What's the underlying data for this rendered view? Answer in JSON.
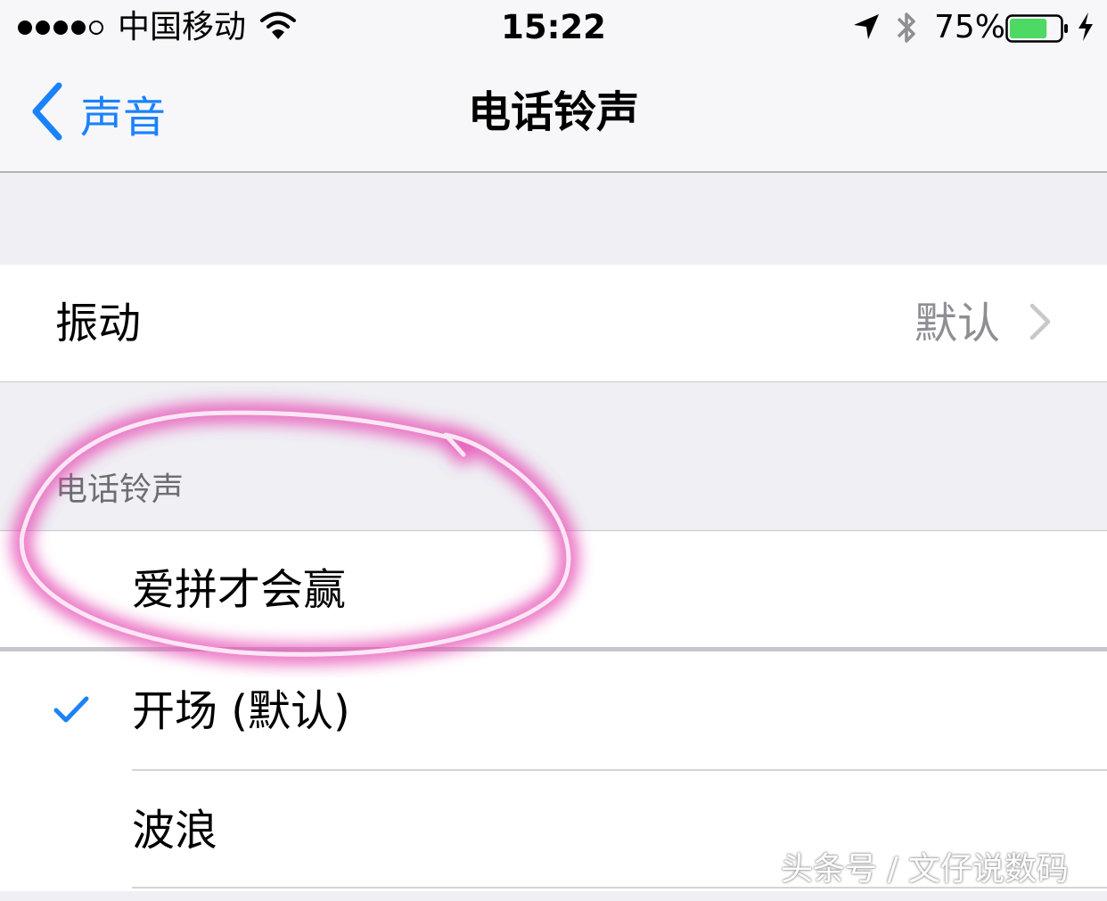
{
  "status_bar": {
    "carrier": "中国移动",
    "time": "15:22",
    "battery_percent": "75%",
    "battery_level": 0.75,
    "signal_bars": 4,
    "icons": [
      "wifi-icon",
      "location-arrow-icon",
      "bluetooth-icon",
      "battery-icon",
      "charging-bolt-icon"
    ]
  },
  "nav": {
    "back_label": "声音",
    "title": "电话铃声"
  },
  "vibration": {
    "label": "振动",
    "value": "默认"
  },
  "ringtones": {
    "section_header": "电话铃声",
    "items": [
      {
        "label": "爱拼才会赢",
        "selected": false
      },
      {
        "label": "开场 (默认)",
        "selected": true
      },
      {
        "label": "波浪",
        "selected": false
      }
    ]
  },
  "watermark": "头条号 / 文仔说数码",
  "colors": {
    "accent": "#1a82fb",
    "battery": "#4cd964",
    "annotation": "#e64bb4"
  }
}
